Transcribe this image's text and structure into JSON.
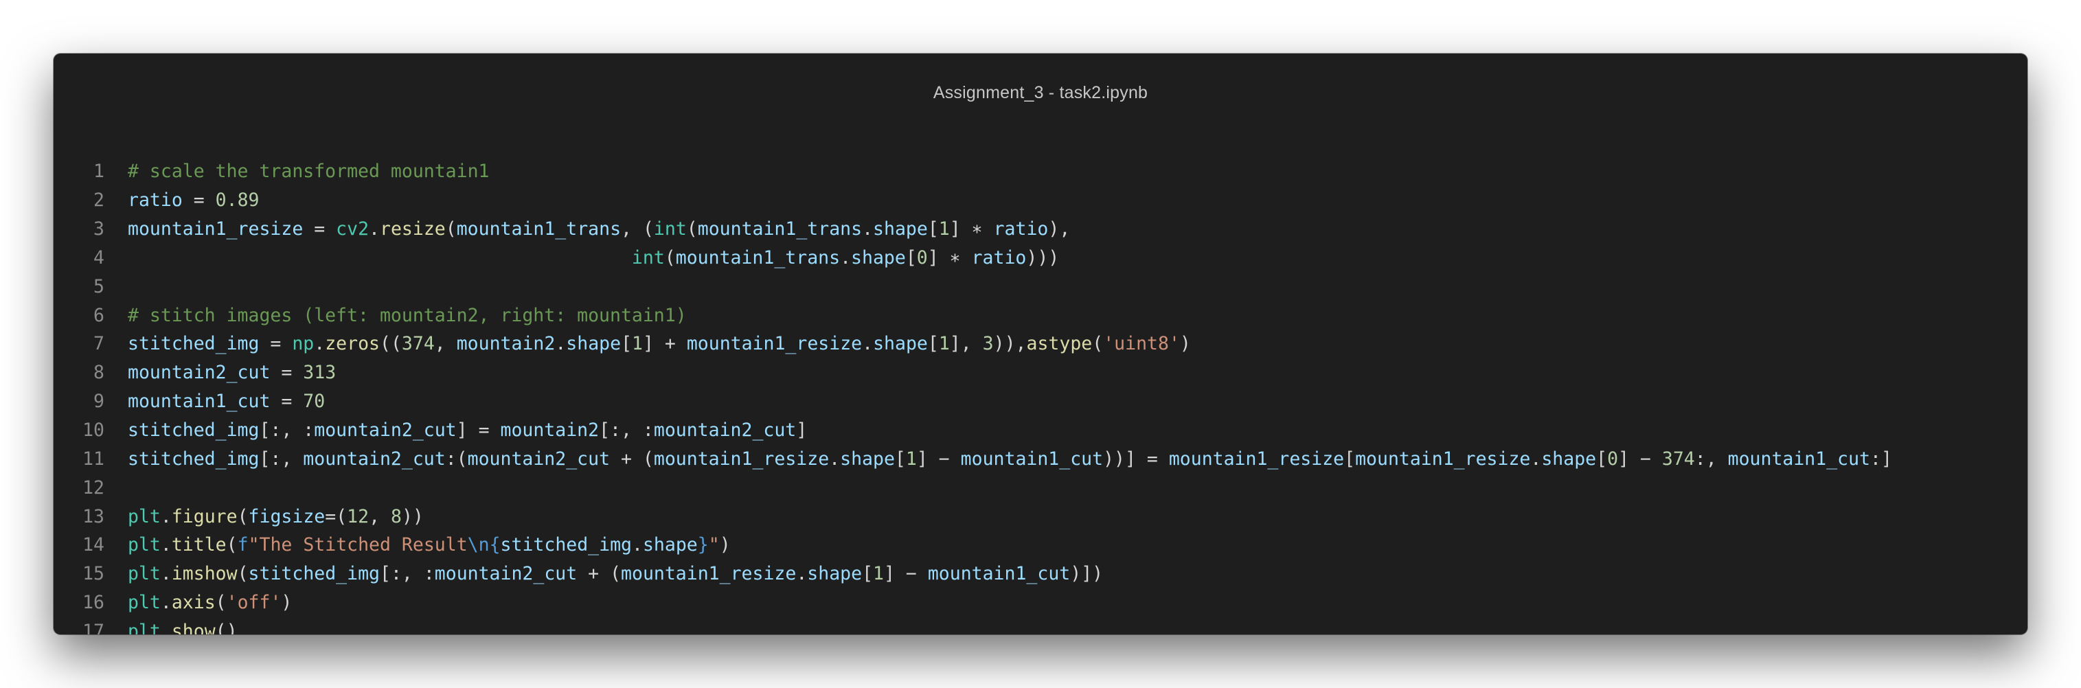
{
  "window": {
    "title": "Assignment_3 - task2.ipynb"
  },
  "colors": {
    "background": "#1e1e1e",
    "comment": "#6a9955",
    "variable": "#9cdcfe",
    "number": "#b5cea8",
    "function": "#dcdcaa",
    "builtin": "#4ec9b0",
    "string": "#ce9178",
    "keyword": "#569cd6",
    "line_number": "#8a8a8a"
  },
  "code": {
    "language": "python",
    "lines": [
      {
        "n": "1",
        "tokens": [
          [
            "c",
            "# scale the transformed mountain1"
          ]
        ]
      },
      {
        "n": "2",
        "tokens": [
          [
            "v",
            "ratio"
          ],
          [
            "o",
            " = "
          ],
          [
            "n",
            "0.89"
          ]
        ]
      },
      {
        "n": "3",
        "tokens": [
          [
            "v",
            "mountain1_resize"
          ],
          [
            "o",
            " = "
          ],
          [
            "b",
            "cv2"
          ],
          [
            "o",
            "."
          ],
          [
            "f",
            "resize"
          ],
          [
            "o",
            "("
          ],
          [
            "v",
            "mountain1_trans"
          ],
          [
            "o",
            ", ("
          ],
          [
            "b",
            "int"
          ],
          [
            "o",
            "("
          ],
          [
            "v",
            "mountain1_trans"
          ],
          [
            "o",
            "."
          ],
          [
            "v",
            "shape"
          ],
          [
            "o",
            "["
          ],
          [
            "n",
            "1"
          ],
          [
            "o",
            "] ∗ "
          ],
          [
            "v",
            "ratio"
          ],
          [
            "o",
            "),"
          ]
        ]
      },
      {
        "n": "4",
        "tokens": [
          [
            "o",
            "                                              "
          ],
          [
            "b",
            "int"
          ],
          [
            "o",
            "("
          ],
          [
            "v",
            "mountain1_trans"
          ],
          [
            "o",
            "."
          ],
          [
            "v",
            "shape"
          ],
          [
            "o",
            "["
          ],
          [
            "n",
            "0"
          ],
          [
            "o",
            "] ∗ "
          ],
          [
            "v",
            "ratio"
          ],
          [
            "o",
            ")))"
          ]
        ]
      },
      {
        "n": "5",
        "tokens": []
      },
      {
        "n": "6",
        "tokens": [
          [
            "c",
            "# stitch images (left: mountain2, right: mountain1)"
          ]
        ]
      },
      {
        "n": "7",
        "tokens": [
          [
            "v",
            "stitched_img"
          ],
          [
            "o",
            " = "
          ],
          [
            "b",
            "np"
          ],
          [
            "o",
            "."
          ],
          [
            "f",
            "zeros"
          ],
          [
            "o",
            "(("
          ],
          [
            "n",
            "374"
          ],
          [
            "o",
            ", "
          ],
          [
            "v",
            "mountain2"
          ],
          [
            "o",
            "."
          ],
          [
            "v",
            "shape"
          ],
          [
            "o",
            "["
          ],
          [
            "n",
            "1"
          ],
          [
            "o",
            "] + "
          ],
          [
            "v",
            "mountain1_resize"
          ],
          [
            "o",
            "."
          ],
          [
            "v",
            "shape"
          ],
          [
            "o",
            "["
          ],
          [
            "n",
            "1"
          ],
          [
            "o",
            "], "
          ],
          [
            "n",
            "3"
          ],
          [
            "o",
            ")),"
          ],
          [
            "f",
            "astype"
          ],
          [
            "o",
            "("
          ],
          [
            "s",
            "'uint8'"
          ],
          [
            "o",
            ")"
          ]
        ]
      },
      {
        "n": "8",
        "tokens": [
          [
            "v",
            "mountain2_cut"
          ],
          [
            "o",
            " = "
          ],
          [
            "n",
            "313"
          ]
        ]
      },
      {
        "n": "9",
        "tokens": [
          [
            "v",
            "mountain1_cut"
          ],
          [
            "o",
            " = "
          ],
          [
            "n",
            "70"
          ]
        ]
      },
      {
        "n": "10",
        "tokens": [
          [
            "v",
            "stitched_img"
          ],
          [
            "o",
            "[:, :"
          ],
          [
            "v",
            "mountain2_cut"
          ],
          [
            "o",
            "] = "
          ],
          [
            "v",
            "mountain2"
          ],
          [
            "o",
            "[:, :"
          ],
          [
            "v",
            "mountain2_cut"
          ],
          [
            "o",
            "]"
          ]
        ]
      },
      {
        "n": "11",
        "tokens": [
          [
            "v",
            "stitched_img"
          ],
          [
            "o",
            "[:, "
          ],
          [
            "v",
            "mountain2_cut"
          ],
          [
            "o",
            ":("
          ],
          [
            "v",
            "mountain2_cut"
          ],
          [
            "o",
            " + ("
          ],
          [
            "v",
            "mountain1_resize"
          ],
          [
            "o",
            "."
          ],
          [
            "v",
            "shape"
          ],
          [
            "o",
            "["
          ],
          [
            "n",
            "1"
          ],
          [
            "o",
            "] − "
          ],
          [
            "v",
            "mountain1_cut"
          ],
          [
            "o",
            "))] = "
          ],
          [
            "v",
            "mountain1_resize"
          ],
          [
            "o",
            "["
          ],
          [
            "v",
            "mountain1_resize"
          ],
          [
            "o",
            "."
          ],
          [
            "v",
            "shape"
          ],
          [
            "o",
            "["
          ],
          [
            "n",
            "0"
          ],
          [
            "o",
            "] − "
          ],
          [
            "n",
            "374"
          ],
          [
            "o",
            ":, "
          ],
          [
            "v",
            "mountain1_cut"
          ],
          [
            "o",
            ":]"
          ]
        ]
      },
      {
        "n": "12",
        "tokens": []
      },
      {
        "n": "13",
        "tokens": [
          [
            "b",
            "plt"
          ],
          [
            "o",
            "."
          ],
          [
            "f",
            "figure"
          ],
          [
            "o",
            "("
          ],
          [
            "v",
            "figsize"
          ],
          [
            "o",
            "=("
          ],
          [
            "n",
            "12"
          ],
          [
            "o",
            ", "
          ],
          [
            "n",
            "8"
          ],
          [
            "o",
            "))"
          ]
        ]
      },
      {
        "n": "14",
        "tokens": [
          [
            "b",
            "plt"
          ],
          [
            "o",
            "."
          ],
          [
            "f",
            "title"
          ],
          [
            "o",
            "("
          ],
          [
            "k",
            "f"
          ],
          [
            "s",
            "\"The Stitched Result"
          ],
          [
            "k",
            "\\n"
          ],
          [
            "k",
            "{"
          ],
          [
            "v",
            "stitched_img"
          ],
          [
            "o",
            "."
          ],
          [
            "v",
            "shape"
          ],
          [
            "k",
            "}"
          ],
          [
            "s",
            "\""
          ],
          [
            "o",
            ")"
          ]
        ]
      },
      {
        "n": "15",
        "tokens": [
          [
            "b",
            "plt"
          ],
          [
            "o",
            "."
          ],
          [
            "f",
            "imshow"
          ],
          [
            "o",
            "("
          ],
          [
            "v",
            "stitched_img"
          ],
          [
            "o",
            "[:, :"
          ],
          [
            "v",
            "mountain2_cut"
          ],
          [
            "o",
            " + ("
          ],
          [
            "v",
            "mountain1_resize"
          ],
          [
            "o",
            "."
          ],
          [
            "v",
            "shape"
          ],
          [
            "o",
            "["
          ],
          [
            "n",
            "1"
          ],
          [
            "o",
            "] − "
          ],
          [
            "v",
            "mountain1_cut"
          ],
          [
            "o",
            ")])"
          ]
        ]
      },
      {
        "n": "16",
        "tokens": [
          [
            "b",
            "plt"
          ],
          [
            "o",
            "."
          ],
          [
            "f",
            "axis"
          ],
          [
            "o",
            "("
          ],
          [
            "s",
            "'off'"
          ],
          [
            "o",
            ")"
          ]
        ]
      },
      {
        "n": "17",
        "tokens": [
          [
            "b",
            "plt"
          ],
          [
            "o",
            "."
          ],
          [
            "f",
            "show"
          ],
          [
            "o",
            "()"
          ]
        ]
      }
    ]
  }
}
